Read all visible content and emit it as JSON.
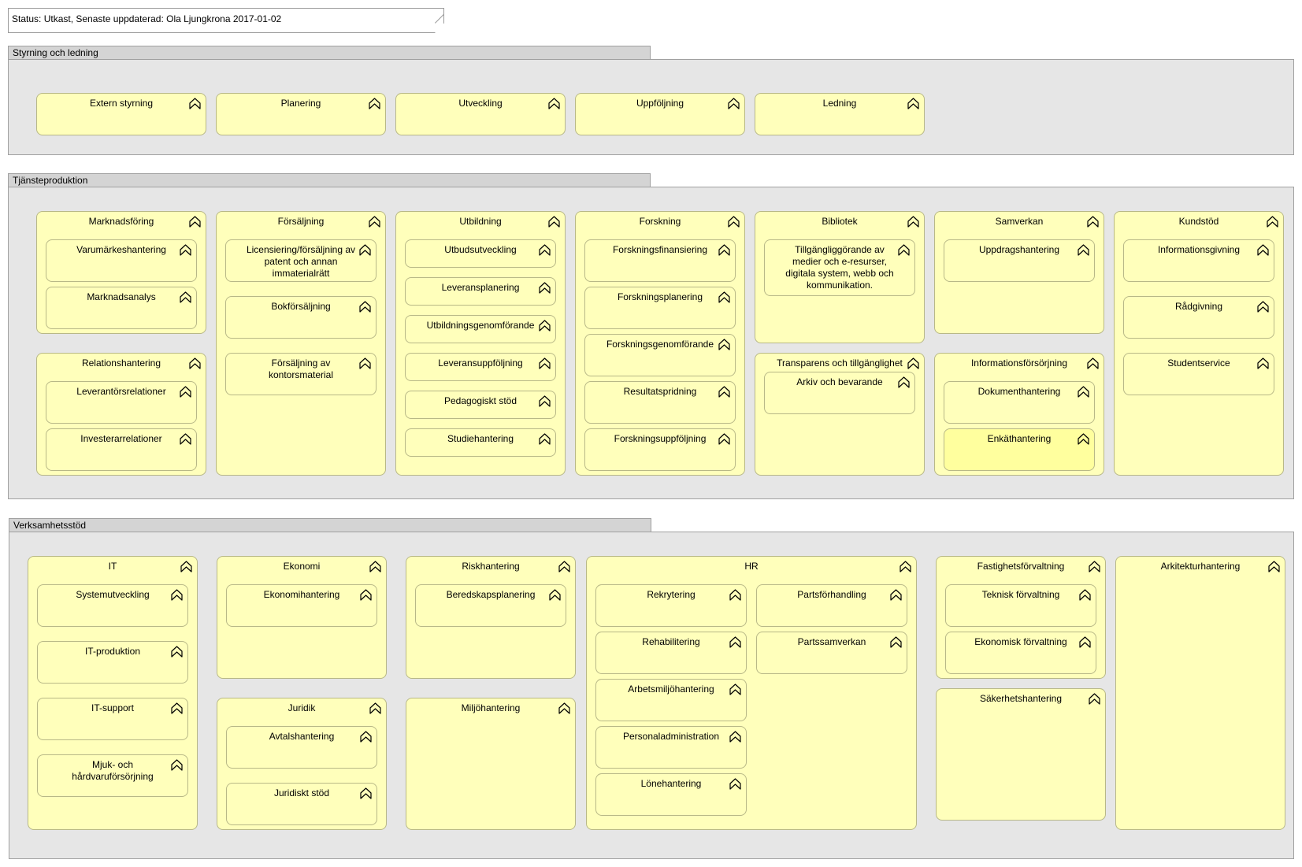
{
  "status_note": "Status: Utkast, Senaste uppdaterad: Ola Ljungkrona 2017-01-02",
  "groups": {
    "styrning": "Styrning och ledning",
    "tjanst": "Tjänsteproduktion",
    "verksamhet": "Verksamhetsstöd"
  },
  "icon": "capability-chevron-icon",
  "colors": {
    "capability_fill": "#ffffbb",
    "group_fill": "#e6e6e6"
  },
  "styrning": {
    "extern": "Extern styrning",
    "planering": "Planering",
    "utveckling": "Utveckling",
    "uppfoljning": "Uppföljning",
    "ledning": "Ledning"
  },
  "tjanst": {
    "marknadsforing": "Marknadsföring",
    "varumarke": "Varumärkeshantering",
    "marknadsanalys": "Marknadsanalys",
    "relationshantering": "Relationshantering",
    "leverantorsrel": "Leverantörsrelationer",
    "investerarrel": "Investerarrelationer",
    "forsaljning": "Försäljning",
    "licensiering": "Licensiering/försäljning av patent och annan immaterialrätt",
    "bokforsaljning": "Bokförsäljning",
    "kontorsmaterial": "Försäljning av kontorsmaterial",
    "utbildning": "Utbildning",
    "utbudsutveckling": "Utbudsutveckling",
    "leveransplanering": "Leveransplanering",
    "utbildningsgenomforande": "Utbildningsgenomförande",
    "leveransuppfoljning": "Leveransuppföljning",
    "pedagogiskt": "Pedagogiskt stöd",
    "studiehantering": "Studiehantering",
    "forskning": "Forskning",
    "forskningsfinansiering": "Forskningsfinansiering",
    "forskningsplanering": "Forskningsplanering",
    "forskningsgenomforande": "Forskningsgenomförande",
    "resultatspridning": "Resultatspridning",
    "forskningsuppfoljning": "Forskningsuppföljning",
    "bibliotek": "Bibliotek",
    "tillgangliggorande": "Tillgängliggörande av medier och e-resurser, digitala system, webb och kommunikation.",
    "transparens": "Transparens och tillgänglighet",
    "arkiv": "Arkiv och bevarande",
    "samverkan": "Samverkan",
    "uppdragshantering": "Uppdragshantering",
    "informationsforsorjning": "Informationsförsörjning",
    "dokumenthantering": "Dokumenthantering",
    "enkathantering": "Enkäthantering",
    "kundstod": "Kundstöd",
    "informationsgivning": "Informationsgivning",
    "radgivning": "Rådgivning",
    "studentservice": "Studentservice"
  },
  "verksamhet": {
    "it": "IT",
    "systemutveckling": "Systemutveckling",
    "itproduktion": "IT-produktion",
    "itsupport": "IT-support",
    "mjukhard": "Mjuk- och hårdvaruförsörjning",
    "ekonomi": "Ekonomi",
    "ekonomihantering": "Ekonomihantering",
    "juridik": "Juridik",
    "avtalshantering": "Avtalshantering",
    "juridisktstod": "Juridiskt stöd",
    "riskhantering": "Riskhantering",
    "beredskapsplanering": "Beredskapsplanering",
    "miljohantering": "Miljöhantering",
    "hr": "HR",
    "rekrytering": "Rekrytering",
    "rehabilitering": "Rehabilitering",
    "arbetsmiljo": "Arbetsmiljöhantering",
    "personaladmin": "Personaladministration",
    "lonehantering": "Lönehantering",
    "partsforhandling": "Partsförhandling",
    "partssamverkan": "Partssamverkan",
    "fastighet": "Fastighetsförvaltning",
    "teknisk": "Teknisk förvaltning",
    "ekonomisk": "Ekonomisk förvaltning",
    "sakerhet": "Säkerhetshantering",
    "arkitektur": "Arkitekturhantering"
  }
}
